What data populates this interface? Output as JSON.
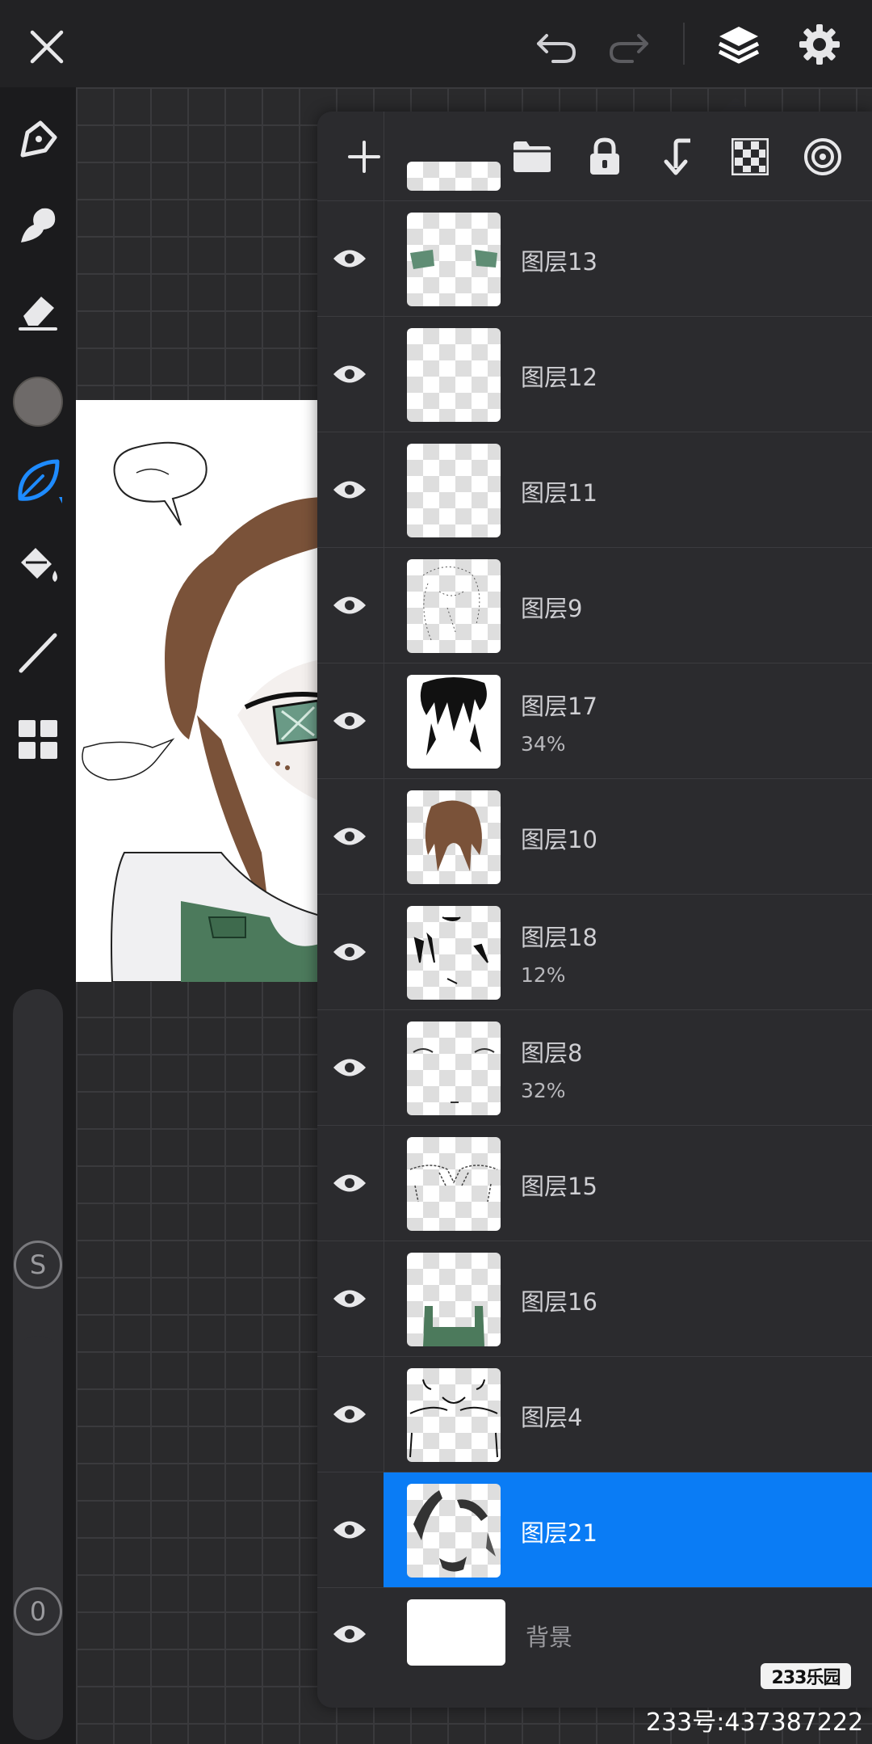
{
  "topbar": {
    "close_icon": "close-icon",
    "undo_icon": "undo-icon",
    "redo_icon": "redo-icon",
    "layers_icon": "layers-icon",
    "settings_icon": "gear-icon"
  },
  "left_toolbar": {
    "tools": [
      "pen-tool-icon",
      "smudge-tool-icon",
      "eraser-icon",
      "color-swatch",
      "leaf-brush-icon",
      "fill-bucket-icon",
      "line-tool-icon",
      "grid-tool-icon"
    ],
    "active_tool": "leaf-brush-icon",
    "current_color": "#6e6a69",
    "size_badge": "S",
    "opacity_badge": "0"
  },
  "layers_panel": {
    "toolbar_icons": [
      "add-layer-icon",
      "folder-icon",
      "lock-icon",
      "merge-down-icon",
      "transparency-icon",
      "blend-mode-icon"
    ],
    "layers": [
      {
        "name": "图层13",
        "opacity": "",
        "thumb": "eyes"
      },
      {
        "name": "图层12",
        "opacity": "",
        "thumb": "empty"
      },
      {
        "name": "图层11",
        "opacity": "",
        "thumb": "empty"
      },
      {
        "name": "图层9",
        "opacity": "",
        "thumb": "sketch"
      },
      {
        "name": "图层17",
        "opacity": "34%",
        "thumb": "black-hair"
      },
      {
        "name": "图层10",
        "opacity": "",
        "thumb": "brown-hair"
      },
      {
        "name": "图层18",
        "opacity": "12%",
        "thumb": "shadows"
      },
      {
        "name": "图层8",
        "opacity": "32%",
        "thumb": "face-lines"
      },
      {
        "name": "图层15",
        "opacity": "",
        "thumb": "collar"
      },
      {
        "name": "图层16",
        "opacity": "",
        "thumb": "overalls"
      },
      {
        "name": "图层4",
        "opacity": "",
        "thumb": "body-lines"
      },
      {
        "name": "图层21",
        "opacity": "",
        "thumb": "dark-marks",
        "selected": true
      }
    ],
    "background_layer": {
      "name": "背景"
    }
  },
  "colors": {
    "accent": "#0a7cf5",
    "panel": "#2b2b2e",
    "hair_brown": "#7a5239",
    "overalls_green": "#4c7a5c"
  },
  "watermark": {
    "logo_text": "233乐园",
    "id_text": "233号:437387222"
  }
}
